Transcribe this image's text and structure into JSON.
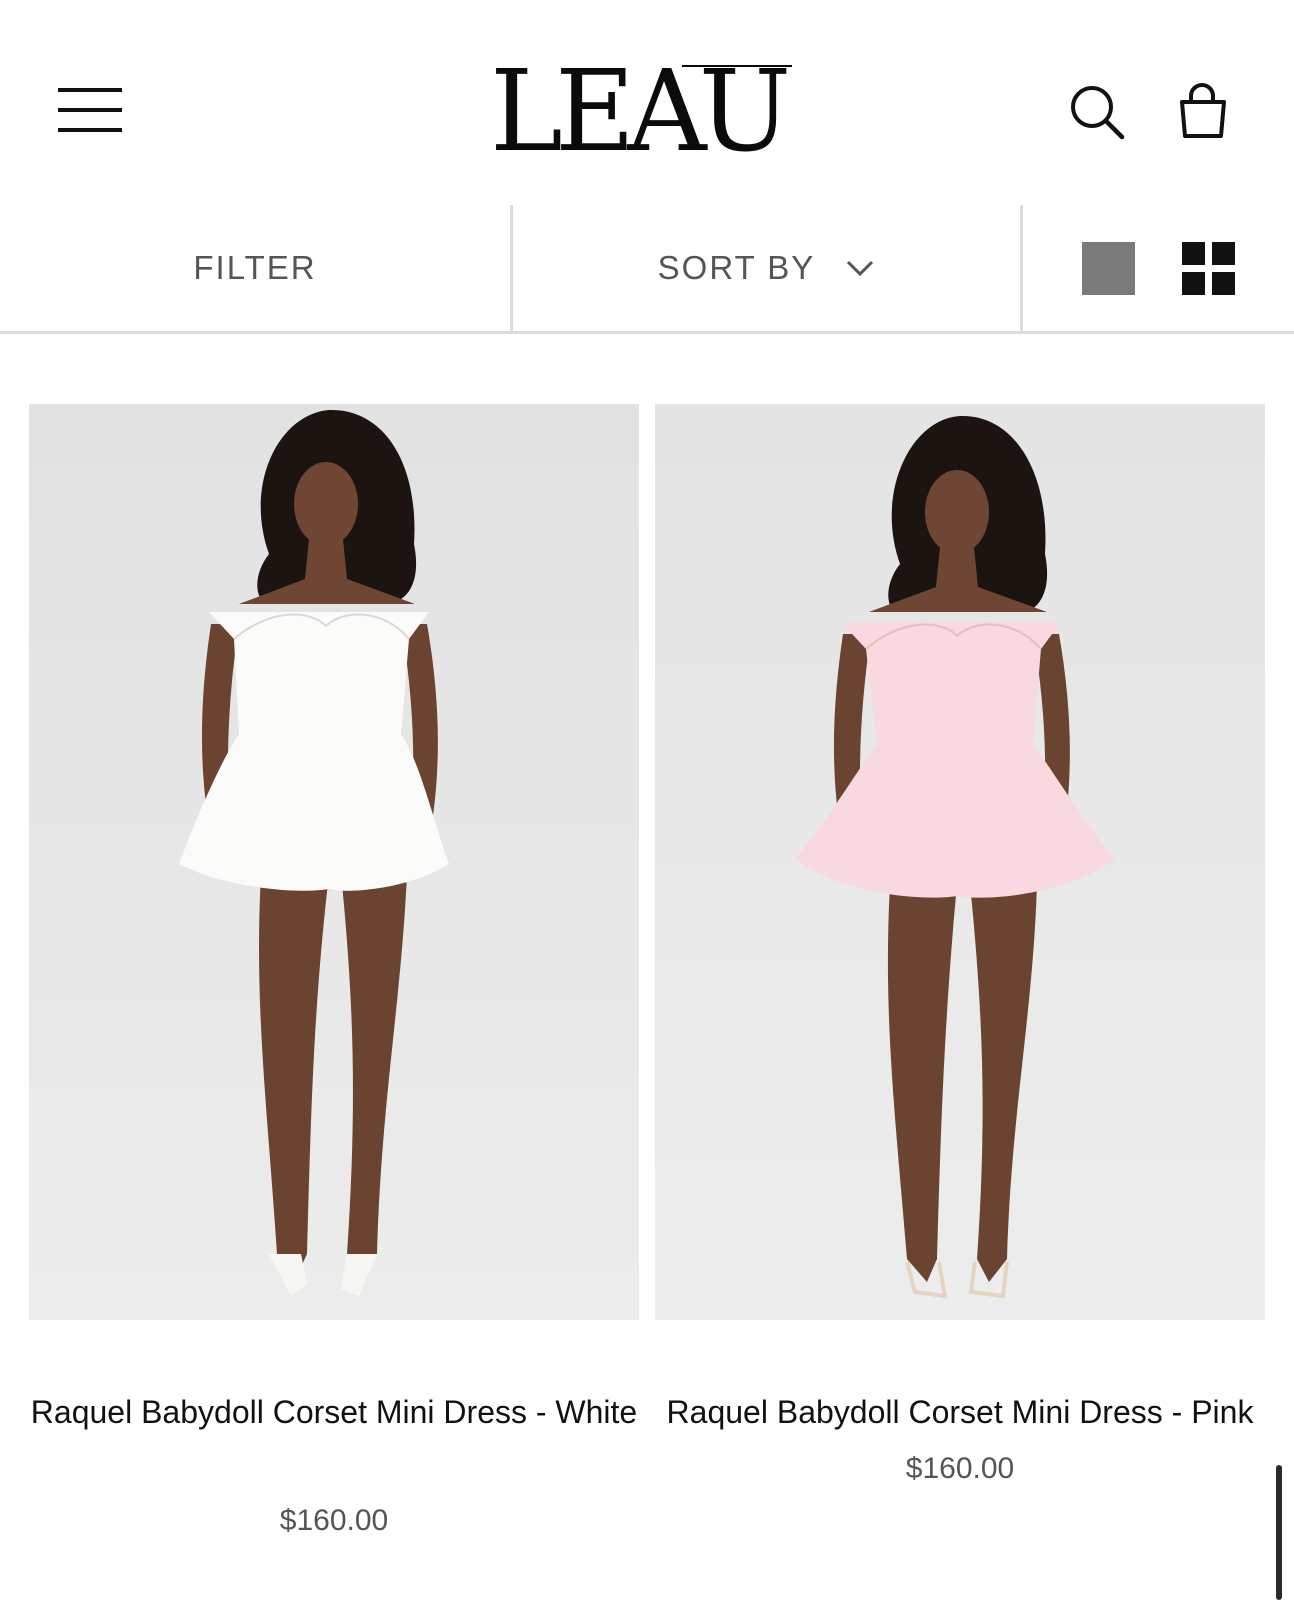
{
  "header": {
    "brand": "LEAU",
    "menu_icon": "hamburger-menu-icon",
    "search_icon": "search-icon",
    "bag_icon": "shopping-bag-icon"
  },
  "toolbar": {
    "filter_label": "FILTER",
    "sort_label": "SORT BY",
    "sort_icon": "chevron-down-icon",
    "view_single_icon": "single-column-view-icon",
    "view_grid_icon": "grid-view-icon"
  },
  "products": [
    {
      "name": "Raquel Babydoll Corset Mini Dress - White",
      "price": "$160.00",
      "dress_color": "#fbfbf9"
    },
    {
      "name": "Raquel Babydoll Corset Mini Dress - Pink",
      "price": "$160.00",
      "dress_color": "#f8d9df"
    }
  ],
  "colors": {
    "background": "#ffffff",
    "photo_background": "#e6e6e6",
    "divider": "#dcdcdc",
    "active_view": "#7a7a7a"
  }
}
